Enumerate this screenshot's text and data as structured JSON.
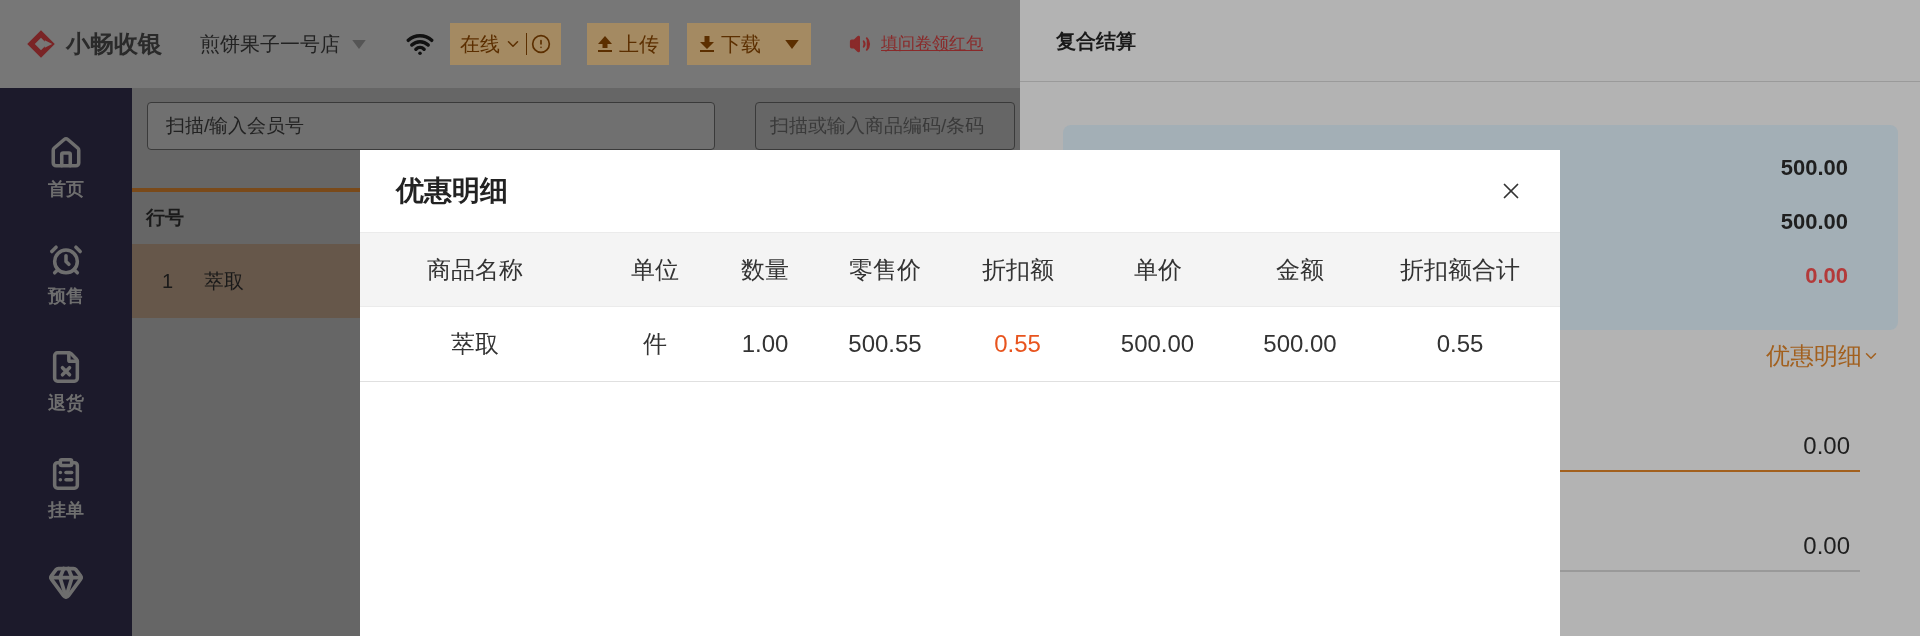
{
  "header": {
    "logo_text": "小畅收银",
    "store": "煎饼果子一号店",
    "status_button": "在线",
    "upload_button": "上传",
    "download_button": "下载",
    "survey_link": "填问卷领红包"
  },
  "sidebar": {
    "items": [
      {
        "label": "首页"
      },
      {
        "label": "预售"
      },
      {
        "label": "退货"
      },
      {
        "label": "挂单"
      }
    ]
  },
  "main": {
    "member_field": {
      "placeholder": "扫描/输入会员号"
    },
    "product_field": {
      "placeholder": "扫描或输入商品编码/条码"
    },
    "table": {
      "columns": [
        "行号"
      ],
      "rows": [
        {
          "cells": [
            "1",
            "萃取"
          ],
          "selected": true
        }
      ]
    }
  },
  "checkout": {
    "title": "复合结算",
    "summary": [
      {
        "value": "500.00",
        "kind": "amount"
      },
      {
        "value": "500.00",
        "kind": "amount"
      },
      {
        "value": "0.00",
        "kind": "due"
      }
    ],
    "details_link": "优惠明细",
    "fields": [
      {
        "value": "0.00",
        "focused": true
      },
      {
        "value": "0.00",
        "focused": false
      }
    ]
  },
  "modal": {
    "title": "优惠明细",
    "columns": [
      "商品名称",
      "单位",
      "数量",
      "零售价",
      "折扣额",
      "单价",
      "金额",
      "折扣额合计"
    ],
    "rows": [
      {
        "cells": [
          {
            "text": "萃取",
            "kind": "plain"
          },
          {
            "text": "件",
            "kind": "plain"
          },
          {
            "text": "1.00",
            "kind": "plain"
          },
          {
            "text": "500.55",
            "kind": "plain"
          },
          {
            "text": "0.55",
            "kind": "discount"
          },
          {
            "text": "500.00",
            "kind": "plain"
          },
          {
            "text": "500.00",
            "kind": "plain"
          },
          {
            "text": "0.55",
            "kind": "plain"
          }
        ]
      }
    ]
  }
}
